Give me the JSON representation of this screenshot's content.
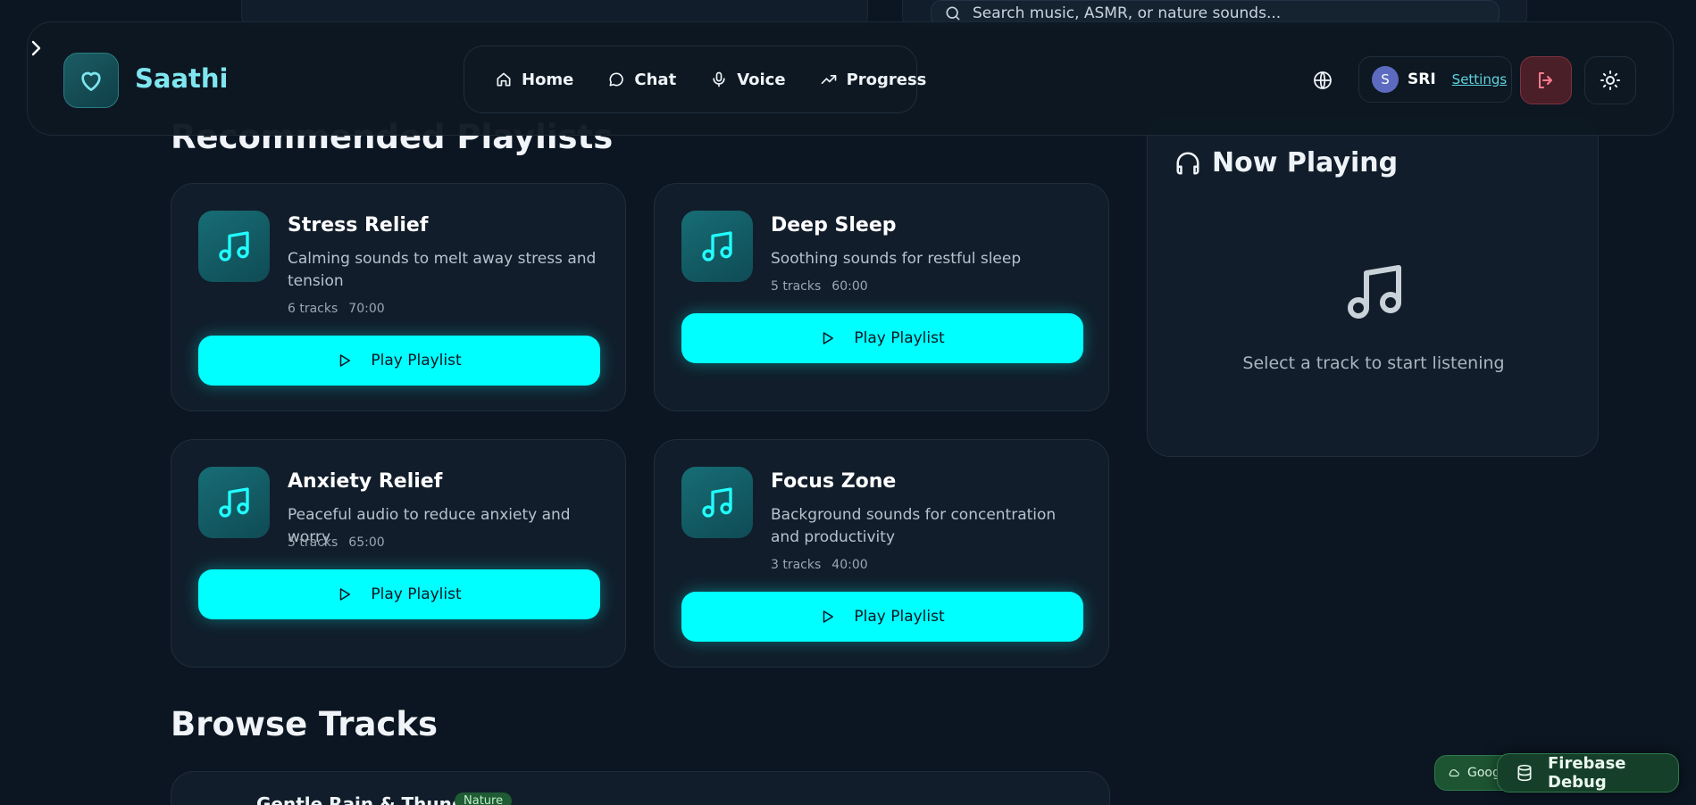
{
  "search": {
    "placeholder": "Search music, ASMR, or nature sounds..."
  },
  "brand": {
    "name": "Saathi"
  },
  "nav": {
    "links": [
      {
        "label": "Home",
        "icon": "home-icon"
      },
      {
        "label": "Chat",
        "icon": "chat-bubble-icon"
      },
      {
        "label": "Voice",
        "icon": "mic-icon"
      },
      {
        "label": "Progress",
        "icon": "trending-up-icon"
      }
    ]
  },
  "user": {
    "initial": "S",
    "name": "SRI",
    "settings_label": "Settings"
  },
  "sections": {
    "recommended_title": "Recommended Playlists",
    "browse_title": "Browse Tracks"
  },
  "playlists": [
    {
      "title": "Stress Relief",
      "description": "Calming sounds to melt away stress and tension",
      "tracks": "6 tracks",
      "duration": "70:00",
      "button": "Play Playlist"
    },
    {
      "title": "Deep Sleep",
      "description": "Soothing sounds for restful sleep",
      "tracks": "5 tracks",
      "duration": "60:00",
      "button": "Play Playlist"
    },
    {
      "title": "Anxiety Relief",
      "description": "Peaceful audio to reduce anxiety and worry",
      "tracks": "5 tracks",
      "duration": "65:00",
      "button": "Play Playlist"
    },
    {
      "title": "Focus Zone",
      "description": "Background sounds for concentration and productivity",
      "tracks": "3 tracks",
      "duration": "40:00",
      "button": "Play Playlist"
    }
  ],
  "now_playing": {
    "title": "Now Playing",
    "empty_message": "Select a track to start listening"
  },
  "tracks": [
    {
      "title": "Gentle Rain & Thunder",
      "badge": "Nature"
    }
  ],
  "debug": {
    "google_label": "Goog",
    "firebase_label": "Firebase Debug"
  },
  "colors": {
    "accent": "#00ffff",
    "background": "#0b1622",
    "card": "#111d2a",
    "brand": "#7fe6ef"
  }
}
